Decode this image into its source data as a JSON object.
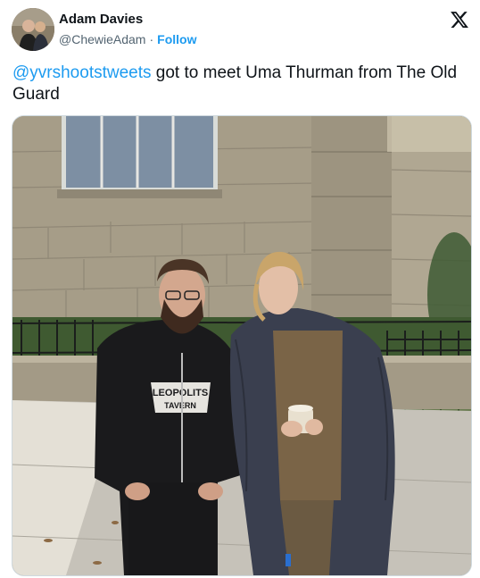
{
  "author": {
    "display_name": "Adam Davies",
    "handle": "@ChewieAdam",
    "separator": "·",
    "follow_label": "Follow"
  },
  "tweet": {
    "mention": "@yvrshootstweets",
    "text": " got to meet Uma Thurman from The Old Guard"
  },
  "photo": {
    "hoodie_print_line1": "LEOPOLITS",
    "hoodie_print_line2": "TAVERN"
  },
  "colors": {
    "link": "#1d9bf0",
    "text": "#0f1419",
    "secondary": "#536471"
  },
  "icons": {
    "platform_logo": "x-logo-icon"
  }
}
